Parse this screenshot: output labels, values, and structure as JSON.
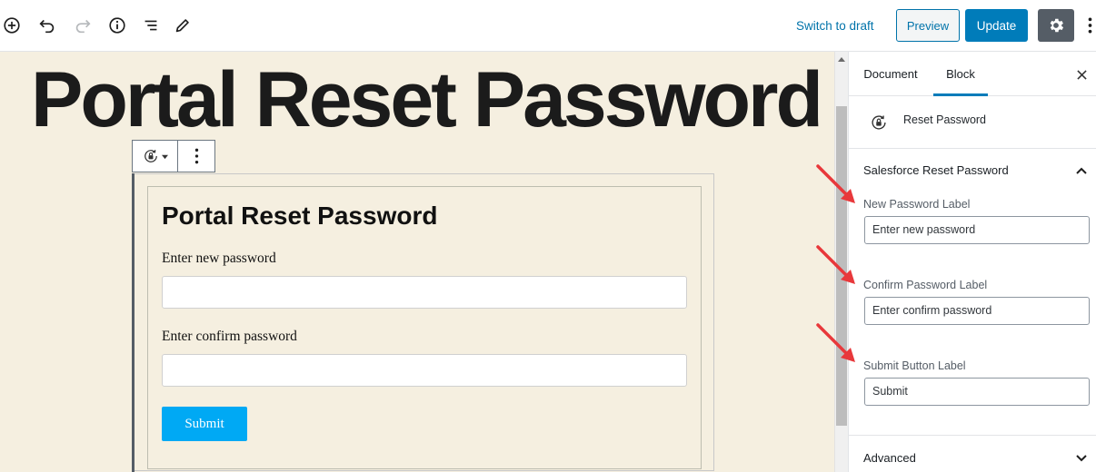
{
  "toolbar": {
    "add_icon": "plus-circle-icon",
    "undo_icon": "undo-icon",
    "redo_icon": "redo-icon",
    "info_icon": "info-icon",
    "outline_icon": "list-view-icon",
    "tools_icon": "pencil-icon",
    "switch_to_draft": "Switch to draft",
    "preview": "Preview",
    "update": "Update",
    "settings_icon": "gear-icon",
    "more_icon": "more-vertical-icon"
  },
  "editor": {
    "post_title": "Portal Reset Password",
    "block_toolbar": {
      "switcher_icon": "lock-reset-icon",
      "more_icon": "more-vertical-icon"
    },
    "form": {
      "heading": "Portal Reset Password",
      "new_password_label": "Enter new password",
      "confirm_password_label": "Enter confirm password",
      "submit_label": "Submit"
    }
  },
  "sidebar": {
    "tabs": [
      {
        "label": "Document",
        "active": false
      },
      {
        "label": "Block",
        "active": true
      }
    ],
    "close_icon": "close-icon",
    "block": {
      "icon": "lock-reset-icon",
      "name": "Reset Password"
    },
    "panels": {
      "salesforce": {
        "title": "Salesforce Reset Password",
        "expanded": true,
        "fields": [
          {
            "label": "New Password Label",
            "value": "Enter new password"
          },
          {
            "label": "Confirm Password Label",
            "value": "Enter confirm password"
          },
          {
            "label": "Submit Button Label",
            "value": "Submit"
          }
        ]
      },
      "advanced": {
        "title": "Advanced",
        "expanded": false
      }
    }
  },
  "colors": {
    "accent": "#007cba",
    "editor_background": "#f5efe0",
    "submit_button": "#00a9f4",
    "annotation_arrow": "#e8383b"
  }
}
